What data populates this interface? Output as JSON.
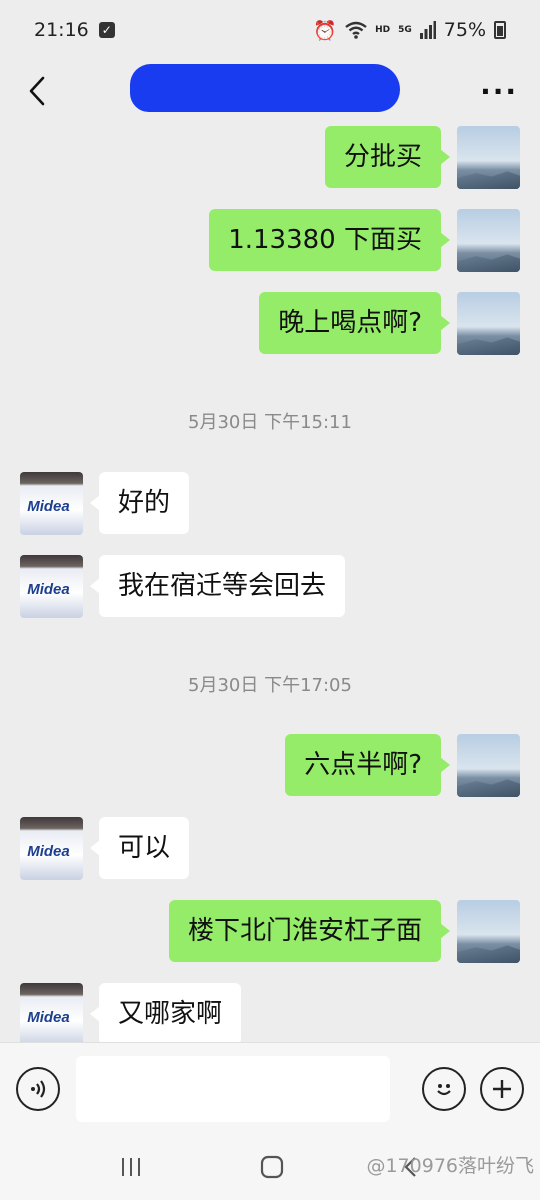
{
  "status_bar": {
    "time": "21:16",
    "network": "5G",
    "hd": "HD",
    "battery": "75%"
  },
  "header": {
    "title": "",
    "more_label": "···"
  },
  "messages": [
    {
      "side": "right",
      "text": "分批买"
    },
    {
      "side": "right",
      "text": "1.13380 下面买"
    },
    {
      "side": "right",
      "text": "晚上喝点啊?"
    },
    {
      "side": "time",
      "text": "5月30日 下午15:11"
    },
    {
      "side": "left",
      "text": "好的"
    },
    {
      "side": "left",
      "text": "我在宿迁等会回去"
    },
    {
      "side": "time",
      "text": "5月30日 下午17:05"
    },
    {
      "side": "right",
      "text": "六点半啊?"
    },
    {
      "side": "left",
      "text": "可以"
    },
    {
      "side": "right",
      "text": "楼下北门淮安杠子面"
    },
    {
      "side": "left",
      "text": "又哪家啊"
    }
  ],
  "contact_avatar_label": "Midea",
  "input": {
    "placeholder": ""
  },
  "watermark": "@170976落叶纷飞",
  "colors": {
    "sent_bubble": "#95ec69",
    "received_bubble": "#ffffff",
    "background": "#ededed"
  }
}
